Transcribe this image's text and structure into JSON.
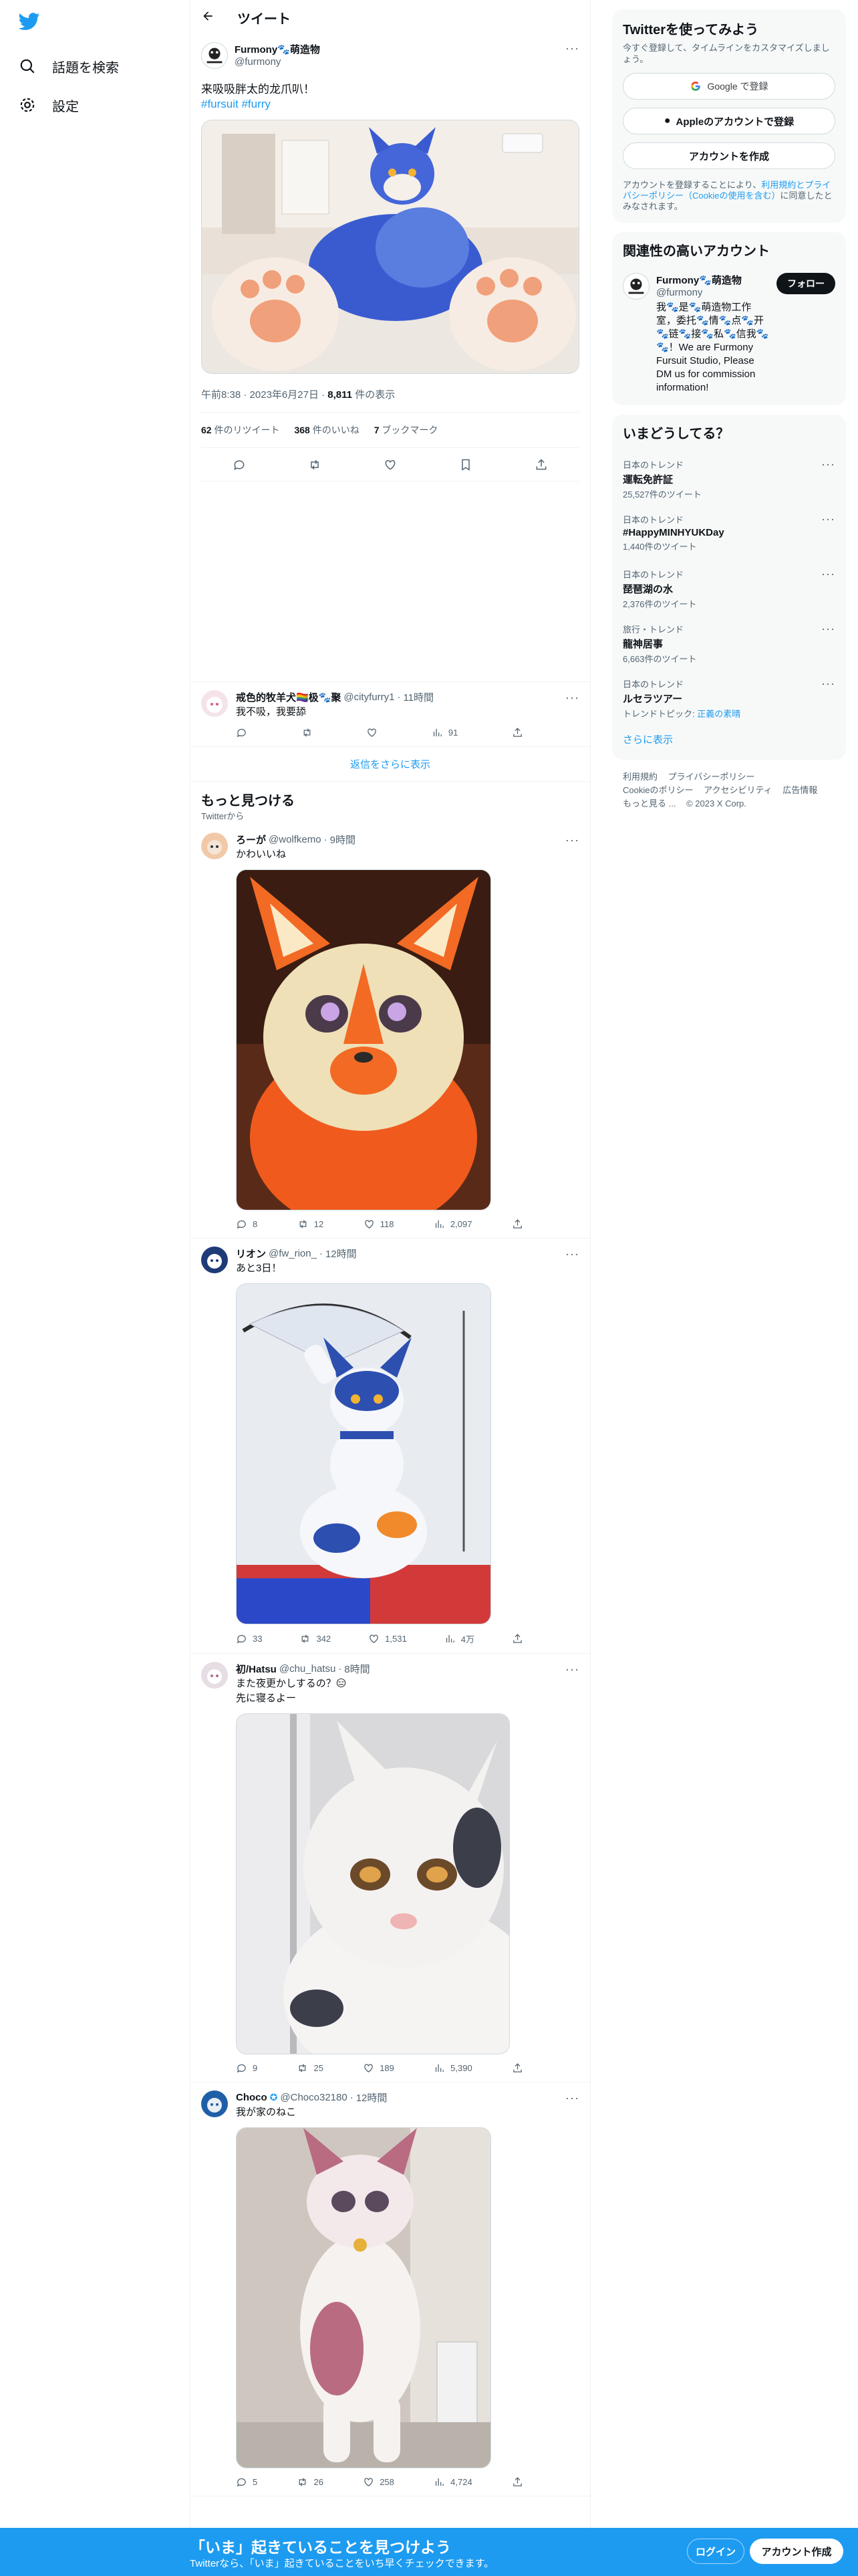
{
  "nav": {
    "explore": "話題を検索",
    "settings": "設定"
  },
  "header": {
    "title": "ツイート"
  },
  "focus_tweet": {
    "display_name": "Furmony🐾萌造物",
    "handle": "@furmony",
    "text": "来吸吸胖太的龙爪叭！",
    "hashtags": "#fursuit #furry",
    "time": "午前8:38",
    "date": "2023年6月27日",
    "views_count": "8,811",
    "views_label": "件の表示",
    "retweets_count": "62",
    "retweets_label": "件のリツイート",
    "likes_count": "368",
    "likes_label": "件のいいね",
    "bookmarks_count": "7",
    "bookmarks_label": "ブックマーク"
  },
  "reply": {
    "display_name": "戒色的牧羊犬🏳️‍🌈极🐾聚",
    "handle": "@cityfurry1",
    "time": "11時間",
    "text": "我不吸，我要舔",
    "views": "91"
  },
  "show_more_replies": "返信をさらに表示",
  "discover": {
    "title": "もっと見つける",
    "subtitle": "Twitterから"
  },
  "tweets": [
    {
      "display_name": "ろーが",
      "handle": "@wolfkemo",
      "time": "9時間",
      "text": "かわいいね",
      "text2": "",
      "replies": "8",
      "retweets": "12",
      "likes": "118",
      "views": "2,097"
    },
    {
      "display_name": "リオン",
      "handle": "@fw_rion_",
      "time": "12時間",
      "text": "あと3日！",
      "text2": "",
      "replies": "33",
      "retweets": "342",
      "likes": "1,531",
      "views": "4万"
    },
    {
      "display_name": "初/Hatsu",
      "handle": "@chu_hatsu",
      "time": "8時間",
      "text": "また夜更かしするの？😑",
      "text2": "先に寝るよー",
      "replies": "9",
      "retweets": "25",
      "likes": "189",
      "views": "5,390"
    },
    {
      "display_name": "Choco",
      "handle": "@Choco32180",
      "time": "12時間",
      "text": "我が家のねこ",
      "text2": "",
      "replies": "5",
      "retweets": "26",
      "likes": "258",
      "views": "4,724"
    }
  ],
  "signup": {
    "title": "Twitterを使ってみよう",
    "desc": "今すぐ登録して、タイムラインをカスタマイズしましょう。",
    "google": "Google で登録",
    "apple": "Appleのアカウントで登録",
    "create": "アカウントを作成",
    "terms_pre": "アカウントを登録することにより、",
    "terms_link1": "利用規約",
    "terms_and": "と",
    "terms_link2": "プライバシーポリシー",
    "terms_link3": "（Cookieの使用を含む）",
    "terms_post": "に同意したとみなされます。"
  },
  "related": {
    "title": "関連性の高いアカウント",
    "display_name": "Furmony🐾萌造物",
    "handle": "@furmony",
    "follow": "フォロー",
    "bio": "我🐾是🐾萌造物工作室，委托🐾情🐾点🐾开🐾链🐾接🐾私🐾信我🐾🐾！We are Furmony Fursuit Studio, Please DM us for commission information!"
  },
  "trends": {
    "title": "いまどうしてる？",
    "items": [
      {
        "category": "日本のトレンド",
        "name": "運転免許証",
        "count": "25,527件のツイート"
      },
      {
        "category": "日本のトレンド",
        "name": "#HappyMINHYUKDay",
        "count": "1,440件のツイート"
      },
      {
        "category": "日本のトレンド",
        "name": "琵琶湖の水",
        "count": "2,376件のツイート"
      },
      {
        "category": "旅行・トレンド",
        "name": "龍神居事",
        "count": "6,663件のツイート"
      },
      {
        "category": "日本のトレンド",
        "name": "ルセラツアー",
        "count": "トレンドトピック: ",
        "link": "正義の素晴"
      }
    ],
    "show_more": "さらに表示"
  },
  "footer": {
    "l1": "利用規約",
    "l2": "プライバシーポリシー",
    "l3": "Cookieのポリシー",
    "l4": "アクセシビリティ",
    "l5": "広告情報",
    "l6": "もっと見る ...",
    "l7": "© 2023 X Corp."
  },
  "bottom": {
    "title": "「いま」起きていることを見つけよう",
    "sub": "Twitterなら、「いま」起きていることをいち早くチェックできます。",
    "login": "ログイン",
    "create": "アカウント作成"
  },
  "colors": {
    "accent": "#1d9bf0",
    "text": "#0f1419",
    "muted": "#536471"
  }
}
